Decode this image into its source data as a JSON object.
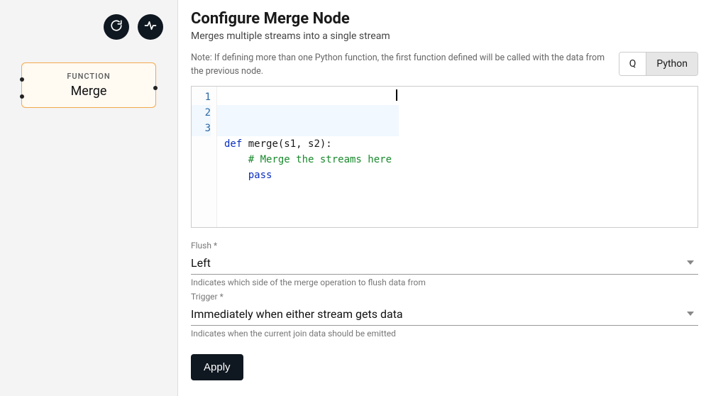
{
  "toolbar": {
    "refresh_icon": "refresh",
    "activity_icon": "activity"
  },
  "node": {
    "type_label": "FUNCTION",
    "name": "Merge"
  },
  "config": {
    "title": "Configure Merge Node",
    "subtitle": "Merges multiple streams into a single stream",
    "note": "Note: If defining more than one Python function, the first function defined will be called with the data from the previous node.",
    "lang_toggle": {
      "q": "Q",
      "python": "Python",
      "active": "Python"
    },
    "editor": {
      "line_numbers": [
        "1",
        "2",
        "3"
      ],
      "code_plain": "def merge(s1, s2):\n    # Merge the streams here\n    pass"
    },
    "fields": {
      "flush": {
        "label": "Flush *",
        "value": "Left",
        "help": "Indicates which side of the merge operation to flush data from"
      },
      "trigger": {
        "label": "Trigger *",
        "value": "Immediately when either stream gets data",
        "help": "Indicates when the current join data should be emitted"
      }
    },
    "apply_label": "Apply"
  }
}
